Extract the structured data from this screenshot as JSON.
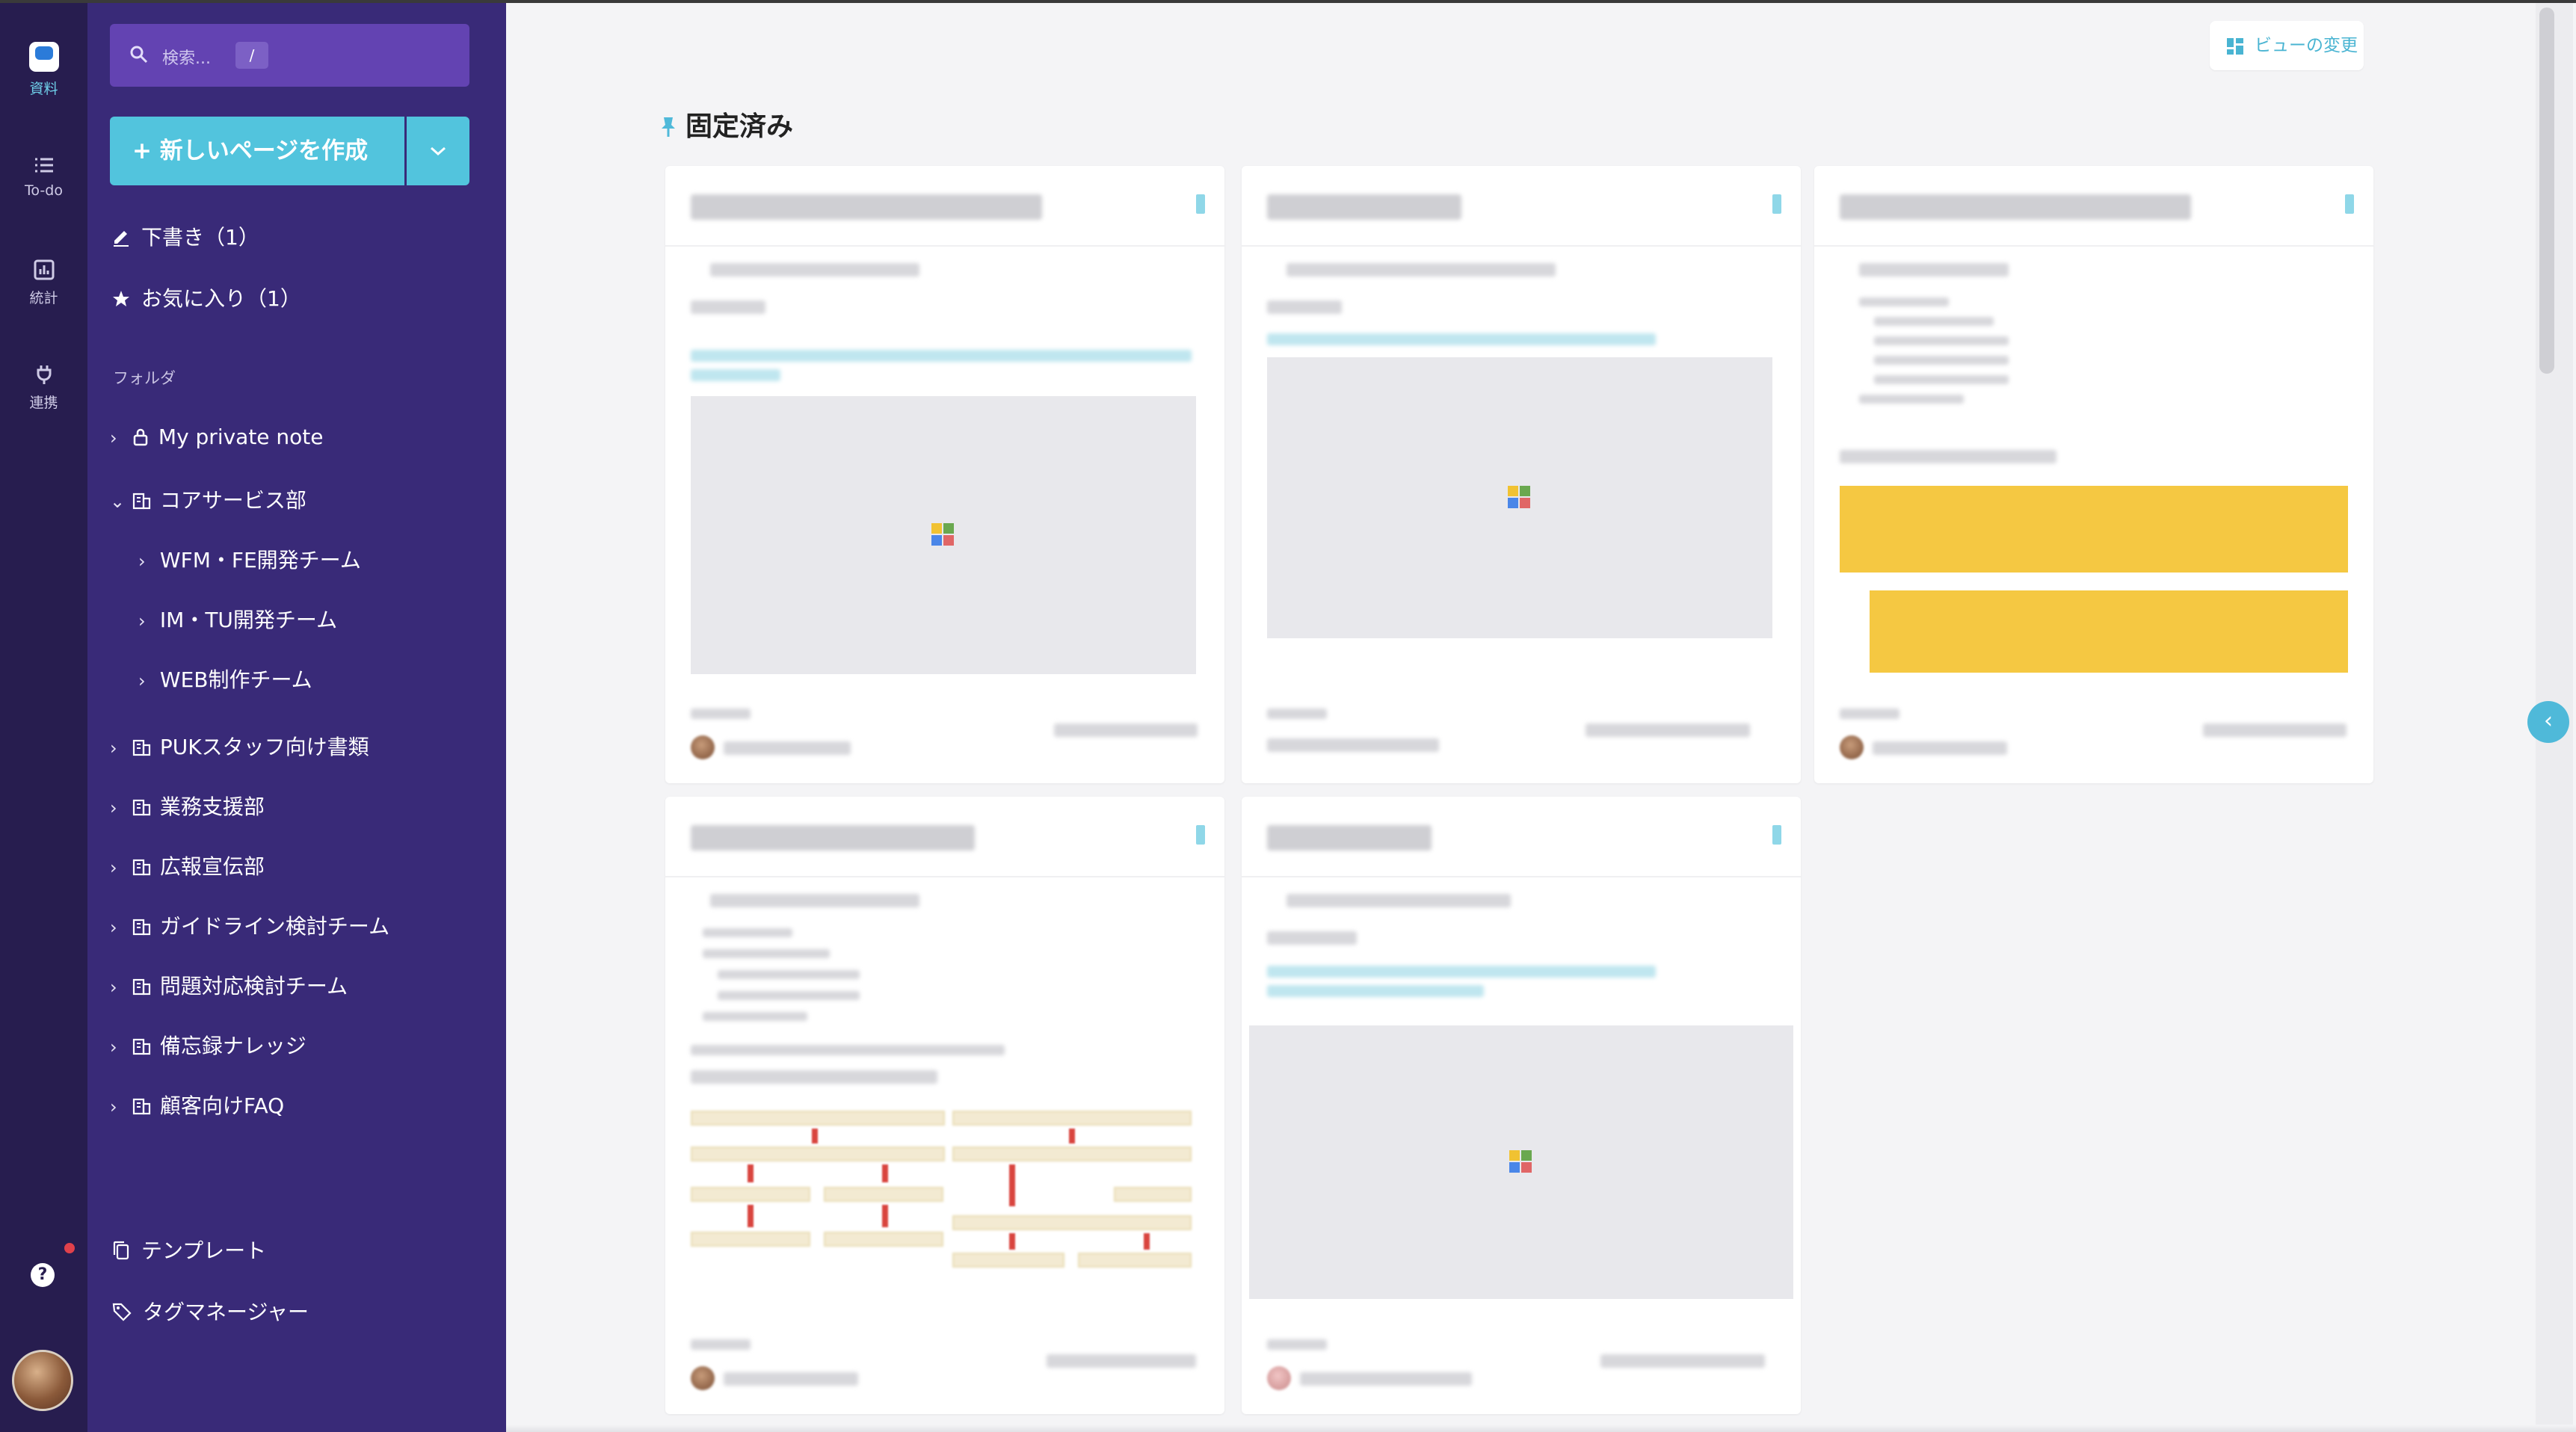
{
  "rail": {
    "items": [
      {
        "label": "資料",
        "icon": "docs-logo-icon",
        "active": true
      },
      {
        "label": "To-do",
        "icon": "list-icon"
      },
      {
        "label": "統計",
        "icon": "chart-icon"
      },
      {
        "label": "連携",
        "icon": "plug-icon"
      }
    ],
    "help_icon": "?"
  },
  "sidebar": {
    "search_placeholder": "検索...",
    "search_shortcut": "/",
    "create_button": "新しいページを作成",
    "drafts": "下書き（1）",
    "favorites": "お気に入り（1）",
    "folders_heading": "フォルダ",
    "folders": [
      {
        "label": "My private note",
        "icon": "lock-icon",
        "expanded": false,
        "level": 0
      },
      {
        "label": "コアサービス部",
        "icon": "building-icon",
        "expanded": true,
        "level": 0
      },
      {
        "label": "WFM・FE開発チーム",
        "level": 1
      },
      {
        "label": "IM・TU開発チーム",
        "level": 1
      },
      {
        "label": "WEB制作チーム",
        "level": 1
      },
      {
        "label": "PUKスタッフ向け書類",
        "icon": "building-icon",
        "level": 0
      },
      {
        "label": "業務支援部",
        "icon": "building-icon",
        "level": 0
      },
      {
        "label": "広報宣伝部",
        "icon": "building-icon",
        "level": 0
      },
      {
        "label": "ガイドライン検討チーム",
        "icon": "building-icon",
        "level": 0
      },
      {
        "label": "問題対応検討チーム",
        "icon": "building-icon",
        "level": 0
      },
      {
        "label": "備忘録ナレッジ",
        "icon": "building-icon",
        "level": 0
      },
      {
        "label": "顧客向けFAQ",
        "icon": "building-icon",
        "level": 0
      }
    ],
    "templates": "テンプレート",
    "tag_manager": "タグマネージャー"
  },
  "main": {
    "view_button": "ビューの変更",
    "pinned_title": "固定済み",
    "accent_color": "#52c4dd",
    "sidebar_color": "#392a78",
    "rail_color": "#271d4f"
  }
}
